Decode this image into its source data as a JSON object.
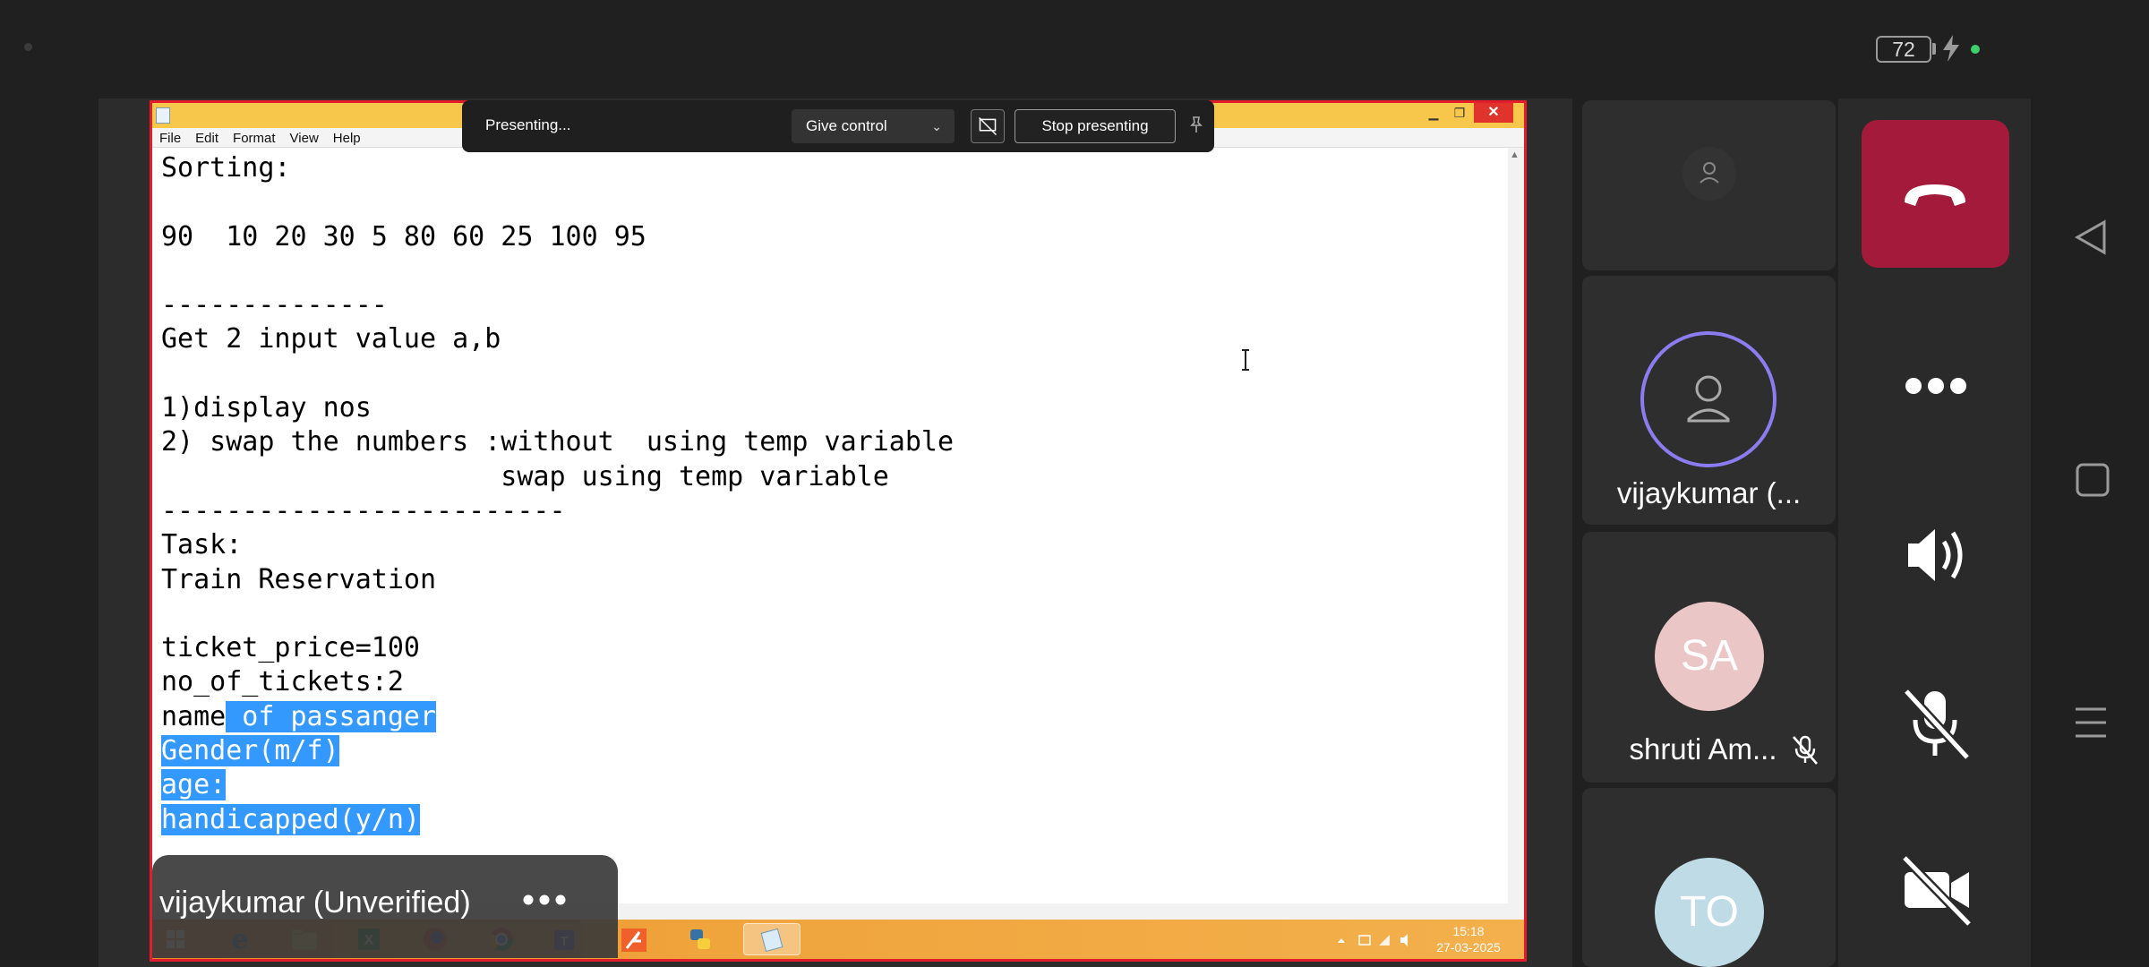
{
  "status_bar": {
    "battery_level": "72",
    "charging": true
  },
  "notepad": {
    "menu": [
      "File",
      "Edit",
      "Format",
      "View",
      "Help"
    ],
    "close_label": "✕",
    "lines": [
      "Sorting:",
      "",
      "90  10 20 30 5 80 60 25 100 95",
      "",
      "--------------",
      "Get 2 input value a,b",
      "",
      "1)display nos",
      "2) swap the numbers :without  using temp variable",
      "                     swap using temp variable",
      "-------------------------",
      "Task:",
      "Train Reservation",
      "",
      "ticket_price=100",
      "no_of_tickets:2"
    ],
    "partial_line_plain": "name",
    "partial_line_selected": " of passanger",
    "selected_lines": [
      "Gender(m/f)",
      "age:",
      "handicapped(y/n)"
    ]
  },
  "taskbar": {
    "time": "15:18",
    "date": "27-03-2025"
  },
  "presenting_toolbar": {
    "status": "Presenting...",
    "give_control_label": "Give control",
    "stop_label": "Stop presenting"
  },
  "presenter": {
    "name": "vijaykumar (Unverified)"
  },
  "participants": [
    {
      "name": "",
      "initials": "",
      "muted": false
    },
    {
      "name": "vijaykumar (...",
      "initials": "",
      "muted": false,
      "speaking": true
    },
    {
      "name": "shruti Am...",
      "initials": "SA",
      "muted": true,
      "avatar_color": "#eac6c6"
    },
    {
      "name": "",
      "initials": "TO",
      "muted": false,
      "avatar_color": "#bfdbe6"
    }
  ],
  "colors": {
    "end_call": "#a31a3a",
    "selection": "#3399ff",
    "speaking_ring": "#8b7cf0",
    "window_border": "#e21c2a"
  }
}
